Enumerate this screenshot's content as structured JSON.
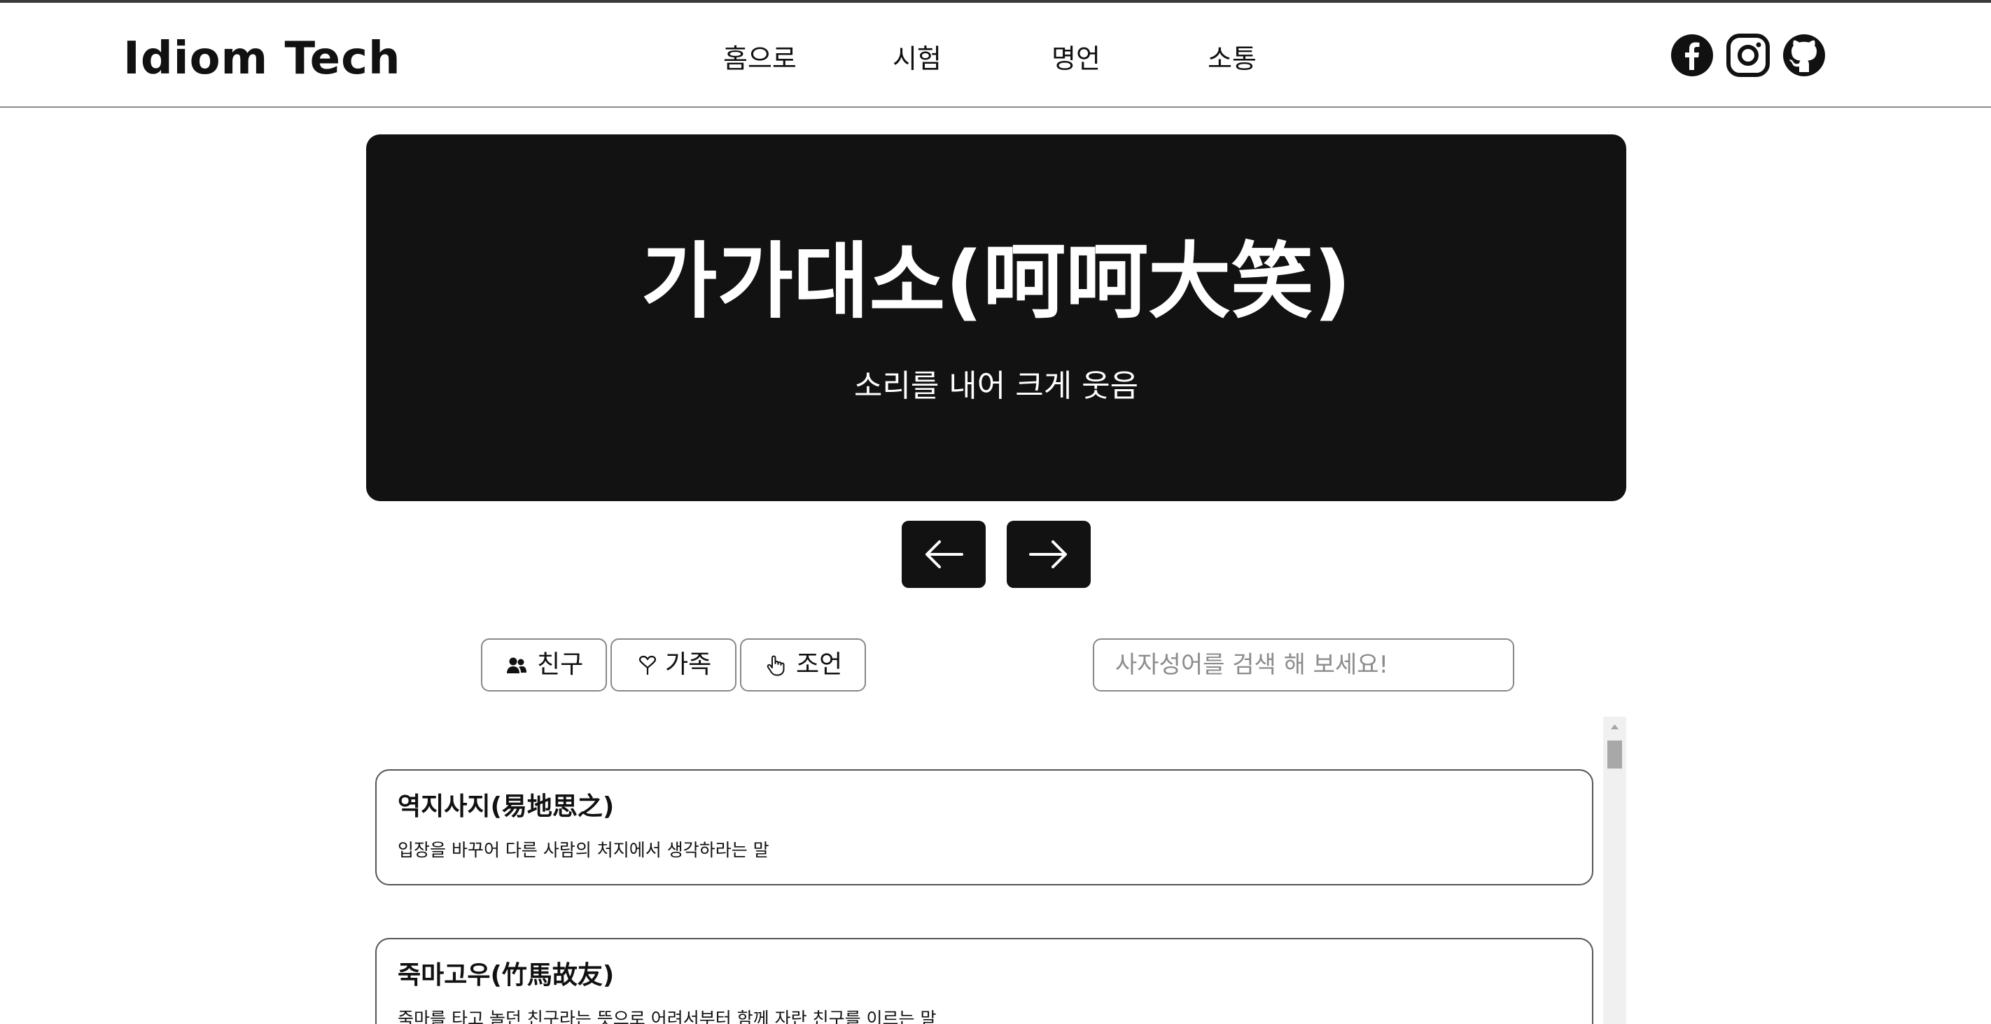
{
  "header": {
    "logo": "Idiom Tech",
    "nav": [
      {
        "label": "홈으로"
      },
      {
        "label": "시험"
      },
      {
        "label": "명언"
      },
      {
        "label": "소통"
      }
    ],
    "socials": [
      "facebook-icon",
      "instagram-icon",
      "github-icon"
    ]
  },
  "hero": {
    "idiom": "가가대소(呵呵大笑)",
    "meaning": "소리를 내어 크게 웃음",
    "prev_icon": "arrow-left-icon",
    "next_icon": "arrow-right-icon"
  },
  "filters": [
    {
      "label": "친구",
      "icon": "users-icon"
    },
    {
      "label": "가족",
      "icon": "heart-icon"
    },
    {
      "label": "조언",
      "icon": "pointing-hand-icon"
    }
  ],
  "search": {
    "placeholder": "사자성어를 검색 해 보세요!",
    "value": ""
  },
  "idioms": [
    {
      "title": "역지사지(易地思之)",
      "desc": "입장을 바꾸어 다른 사람의 처지에서 생각하라는 말"
    },
    {
      "title": "죽마고우(竹馬故友)",
      "desc": "죽마를 타고 놀던 친구라는 뜻으로 어려서부터 함께 자란 친구를 이르는 말"
    }
  ],
  "colors": {
    "hero_bg": "#121212",
    "text": "#111111",
    "border": "#888888",
    "placeholder": "#8c8c8c"
  }
}
